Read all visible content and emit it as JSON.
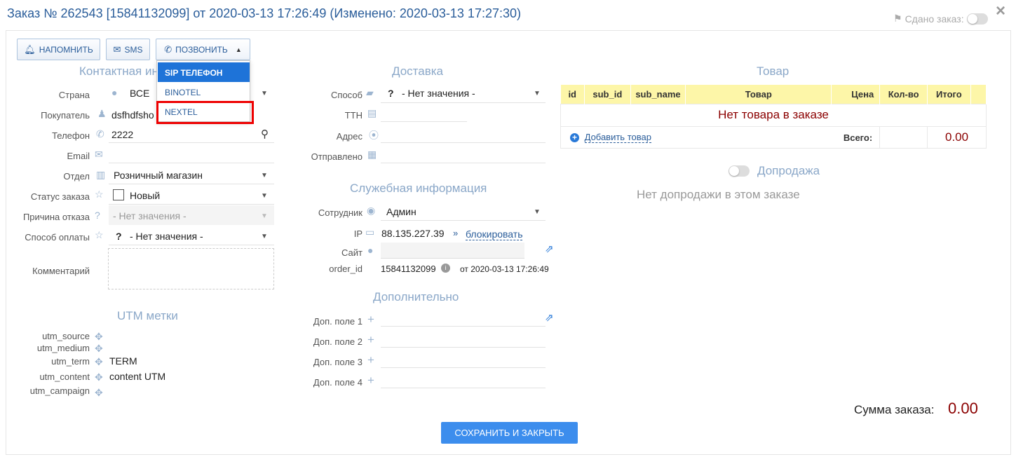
{
  "title": "Заказ № 262543 [15841132099] от 2020-03-13 17:26:49 (Изменено: 2020-03-13 17:27:30)",
  "handed_label": "Сдано заказ:",
  "toolbar": {
    "remind": "НАПОМНИТЬ",
    "sms": "SMS",
    "call": "ПОЗВОНИТЬ"
  },
  "call_menu": [
    "SIP ТЕЛЕФОН",
    "BINOTEL",
    "NEXTEL"
  ],
  "contact": {
    "title": "Контактная ин",
    "country_label": "Страна",
    "country": "ВСЕ",
    "buyer_label": "Покупатель",
    "buyer": "dsfhdfsho",
    "phone_label": "Телефон",
    "phone": "2222",
    "email_label": "Email",
    "dept_label": "Отдел",
    "dept": "Розничный магазин",
    "status_label": "Статус заказа",
    "status": "Новый",
    "reason_label": "Причина отказа",
    "reason": "- Нет значения -",
    "payment_label": "Способ оплаты",
    "payment_q": "?",
    "payment": "- Нет значения -",
    "comment_label": "Комментарий"
  },
  "utm": {
    "title": "UTM метки",
    "source_label": "utm_source",
    "medium_label": "utm_medium",
    "term_label": "utm_term",
    "term": "TERM",
    "content_label": "utm_content",
    "content": "content UTM",
    "campaign_label": "utm_campaign"
  },
  "delivery": {
    "title": "Доставка",
    "method_label": "Способ",
    "method_q": "?",
    "method": "- Нет значения -",
    "ttn_label": "ТТН",
    "address_label": "Адрес",
    "sent_label": "Отправлено"
  },
  "service": {
    "title": "Служебная информация",
    "employee_label": "Сотрудник",
    "employee": "Админ",
    "ip_label": "IP",
    "ip": "88.135.227.39",
    "block_link": "блокировать",
    "site_label": "Сайт",
    "order_id_label": "order_id",
    "order_id": "15841132099",
    "order_date": "от 2020-03-13 17:26:49"
  },
  "extra": {
    "title": "Дополнительно",
    "fields": [
      "Доп. поле 1",
      "Доп. поле 2",
      "Доп. поле 3",
      "Доп. поле 4"
    ]
  },
  "goods": {
    "title": "Товар",
    "columns": [
      "id",
      "sub_id",
      "sub_name",
      "Товар",
      "Цена",
      "Кол-во",
      "Итого"
    ],
    "empty": "Нет товара в заказе",
    "add_link": "Добавить товар",
    "total_label": "Всего:",
    "total": "0.00"
  },
  "upsell": {
    "title": "Допродажа",
    "empty": "Нет допродажи в этом заказе"
  },
  "order_sum_label": "Сумма заказа:",
  "order_sum": "0.00",
  "save_button": "СОХРАНИТЬ И ЗАКРЫТЬ",
  "colors": {
    "accent": "#2a5d9a",
    "primary_button": "#3c8ded",
    "table_header": "#fdf6a8",
    "total_red": "#8b0000",
    "highlight": "#e00000"
  }
}
